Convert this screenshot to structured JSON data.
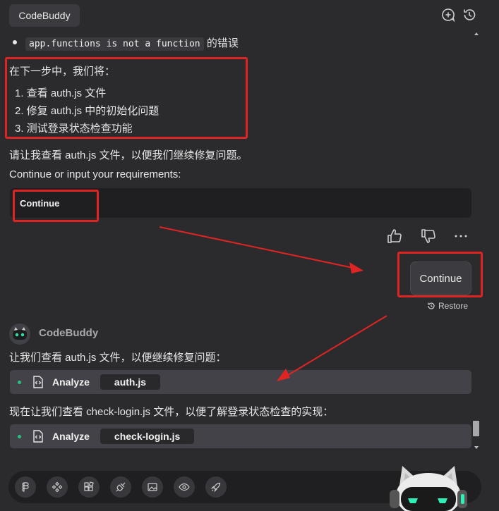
{
  "header": {
    "tab_title": "CodeBuddy",
    "icons": [
      "new-chat-icon",
      "history-icon"
    ]
  },
  "conversation": {
    "error_bullet": {
      "code": "app.functions is not a function",
      "suffix": "的错误"
    },
    "next_steps": {
      "intro": "在下一步中，我们将：",
      "items": [
        "1. 查看 auth.js 文件",
        "2. 修复 auth.js 中的初始化问题",
        "3. 测试登录状态检查功能"
      ]
    },
    "request_line": "请让我查看 auth.js 文件，以便我们继续修复问题。",
    "prompt_line": "Continue or input your requirements:",
    "input_value": "Continue",
    "actions": [
      "thumbs-up-icon",
      "thumbs-down-icon",
      "more-icon"
    ],
    "user_message": "Continue",
    "restore_label": "Restore",
    "assistant_name": "CodeBuddy",
    "assistant_line1": "让我们查看 auth.js 文件，以便继续修复问题：",
    "analyze1": {
      "label": "Analyze",
      "file": "auth.js"
    },
    "assistant_line2": "现在让我们查看 check-login.js 文件，以便了解登录状态检查的实现：",
    "analyze2": {
      "label": "Analyze",
      "file": "check-login.js"
    }
  },
  "toolbar": {
    "icons": [
      "figma-icon",
      "components-icon",
      "blocks-icon",
      "plug-icon",
      "image-icon",
      "eye-icon",
      "rocket-icon"
    ]
  },
  "colors": {
    "background": "#2b2b2e",
    "annotation_red": "#e02424",
    "status_green": "#27c27f",
    "input_bg": "#1f1f22"
  }
}
